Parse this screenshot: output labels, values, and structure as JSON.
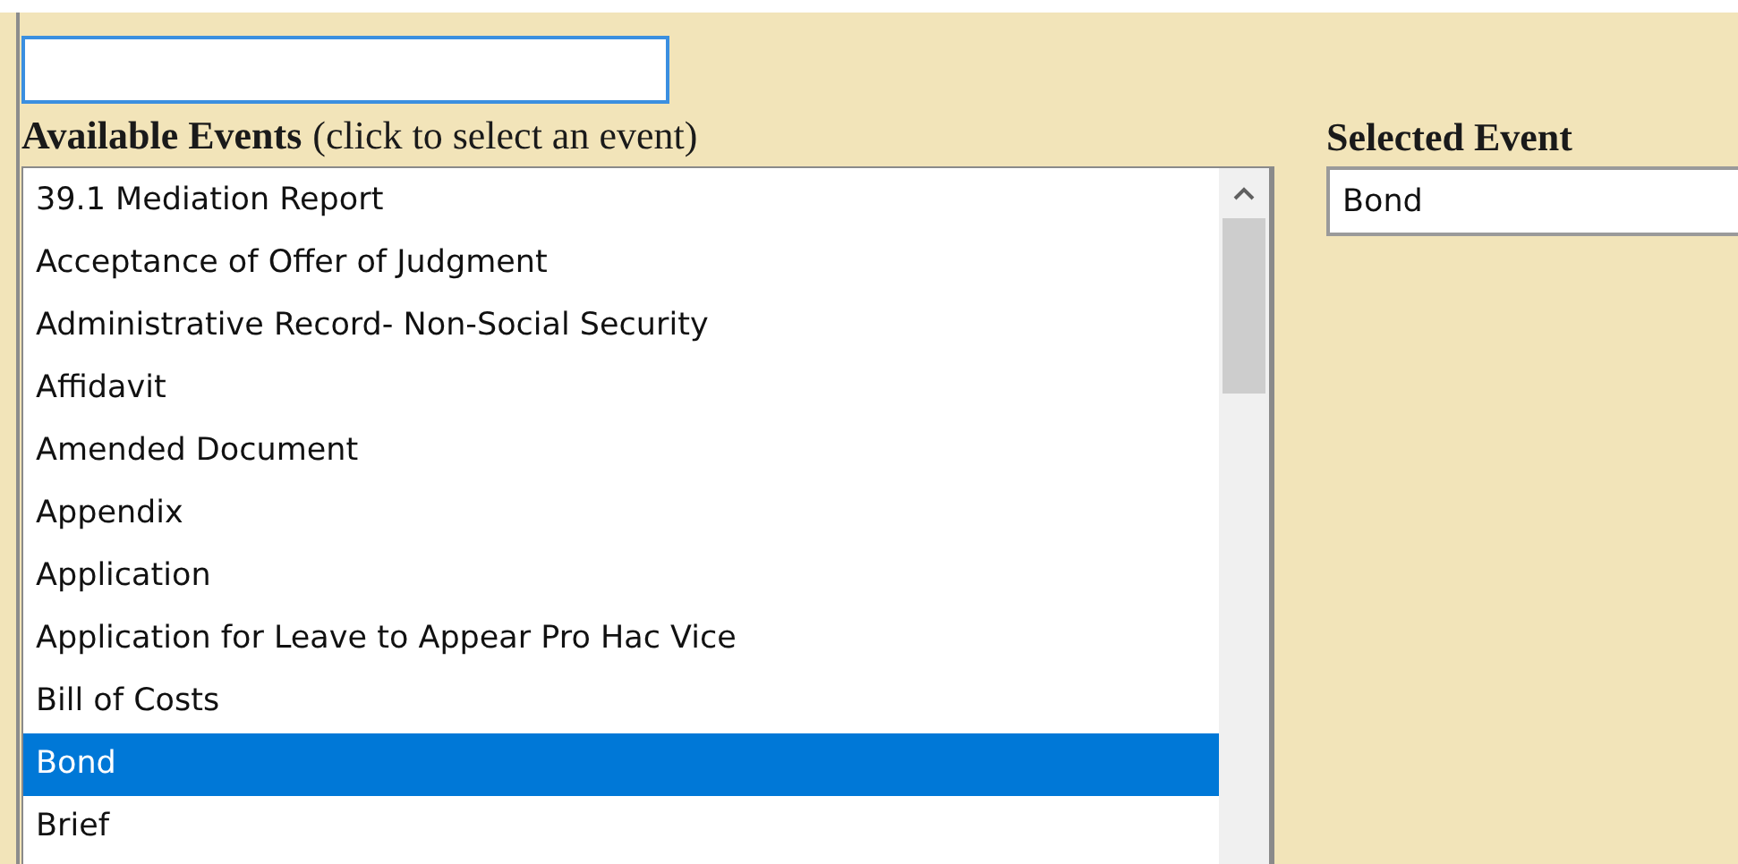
{
  "available_heading": {
    "title": "Available Events",
    "hint": "(click to select an event)"
  },
  "events": [
    {
      "label": "39.1 Mediation Report",
      "selected": false
    },
    {
      "label": "Acceptance of Offer of Judgment",
      "selected": false
    },
    {
      "label": "Administrative Record- Non-Social Security",
      "selected": false
    },
    {
      "label": "Affidavit",
      "selected": false
    },
    {
      "label": "Amended Document",
      "selected": false
    },
    {
      "label": "Appendix",
      "selected": false
    },
    {
      "label": "Application",
      "selected": false
    },
    {
      "label": "Application for Leave to Appear Pro Hac Vice",
      "selected": false
    },
    {
      "label": "Bill of Costs",
      "selected": false
    },
    {
      "label": "Bond",
      "selected": true
    },
    {
      "label": "Brief",
      "selected": false
    }
  ],
  "selected_event": {
    "title": "Selected Event",
    "value": "Bond"
  }
}
